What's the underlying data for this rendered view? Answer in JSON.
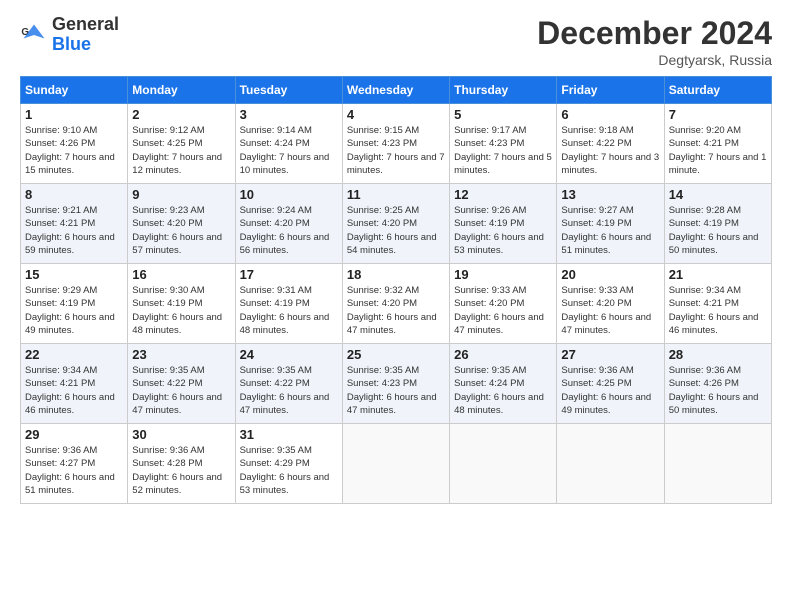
{
  "header": {
    "logo_general": "General",
    "logo_blue": "Blue",
    "month_title": "December 2024",
    "location": "Degtyarsk, Russia"
  },
  "days_of_week": [
    "Sunday",
    "Monday",
    "Tuesday",
    "Wednesday",
    "Thursday",
    "Friday",
    "Saturday"
  ],
  "weeks": [
    [
      {
        "day": "1",
        "sunrise": "9:10 AM",
        "sunset": "4:26 PM",
        "daylight": "7 hours and 15 minutes."
      },
      {
        "day": "2",
        "sunrise": "9:12 AM",
        "sunset": "4:25 PM",
        "daylight": "7 hours and 12 minutes."
      },
      {
        "day": "3",
        "sunrise": "9:14 AM",
        "sunset": "4:24 PM",
        "daylight": "7 hours and 10 minutes."
      },
      {
        "day": "4",
        "sunrise": "9:15 AM",
        "sunset": "4:23 PM",
        "daylight": "7 hours and 7 minutes."
      },
      {
        "day": "5",
        "sunrise": "9:17 AM",
        "sunset": "4:23 PM",
        "daylight": "7 hours and 5 minutes."
      },
      {
        "day": "6",
        "sunrise": "9:18 AM",
        "sunset": "4:22 PM",
        "daylight": "7 hours and 3 minutes."
      },
      {
        "day": "7",
        "sunrise": "9:20 AM",
        "sunset": "4:21 PM",
        "daylight": "7 hours and 1 minute."
      }
    ],
    [
      {
        "day": "8",
        "sunrise": "9:21 AM",
        "sunset": "4:21 PM",
        "daylight": "6 hours and 59 minutes."
      },
      {
        "day": "9",
        "sunrise": "9:23 AM",
        "sunset": "4:20 PM",
        "daylight": "6 hours and 57 minutes."
      },
      {
        "day": "10",
        "sunrise": "9:24 AM",
        "sunset": "4:20 PM",
        "daylight": "6 hours and 56 minutes."
      },
      {
        "day": "11",
        "sunrise": "9:25 AM",
        "sunset": "4:20 PM",
        "daylight": "6 hours and 54 minutes."
      },
      {
        "day": "12",
        "sunrise": "9:26 AM",
        "sunset": "4:19 PM",
        "daylight": "6 hours and 53 minutes."
      },
      {
        "day": "13",
        "sunrise": "9:27 AM",
        "sunset": "4:19 PM",
        "daylight": "6 hours and 51 minutes."
      },
      {
        "day": "14",
        "sunrise": "9:28 AM",
        "sunset": "4:19 PM",
        "daylight": "6 hours and 50 minutes."
      }
    ],
    [
      {
        "day": "15",
        "sunrise": "9:29 AM",
        "sunset": "4:19 PM",
        "daylight": "6 hours and 49 minutes."
      },
      {
        "day": "16",
        "sunrise": "9:30 AM",
        "sunset": "4:19 PM",
        "daylight": "6 hours and 48 minutes."
      },
      {
        "day": "17",
        "sunrise": "9:31 AM",
        "sunset": "4:19 PM",
        "daylight": "6 hours and 48 minutes."
      },
      {
        "day": "18",
        "sunrise": "9:32 AM",
        "sunset": "4:20 PM",
        "daylight": "6 hours and 47 minutes."
      },
      {
        "day": "19",
        "sunrise": "9:33 AM",
        "sunset": "4:20 PM",
        "daylight": "6 hours and 47 minutes."
      },
      {
        "day": "20",
        "sunrise": "9:33 AM",
        "sunset": "4:20 PM",
        "daylight": "6 hours and 47 minutes."
      },
      {
        "day": "21",
        "sunrise": "9:34 AM",
        "sunset": "4:21 PM",
        "daylight": "6 hours and 46 minutes."
      }
    ],
    [
      {
        "day": "22",
        "sunrise": "9:34 AM",
        "sunset": "4:21 PM",
        "daylight": "6 hours and 46 minutes."
      },
      {
        "day": "23",
        "sunrise": "9:35 AM",
        "sunset": "4:22 PM",
        "daylight": "6 hours and 47 minutes."
      },
      {
        "day": "24",
        "sunrise": "9:35 AM",
        "sunset": "4:22 PM",
        "daylight": "6 hours and 47 minutes."
      },
      {
        "day": "25",
        "sunrise": "9:35 AM",
        "sunset": "4:23 PM",
        "daylight": "6 hours and 47 minutes."
      },
      {
        "day": "26",
        "sunrise": "9:35 AM",
        "sunset": "4:24 PM",
        "daylight": "6 hours and 48 minutes."
      },
      {
        "day": "27",
        "sunrise": "9:36 AM",
        "sunset": "4:25 PM",
        "daylight": "6 hours and 49 minutes."
      },
      {
        "day": "28",
        "sunrise": "9:36 AM",
        "sunset": "4:26 PM",
        "daylight": "6 hours and 50 minutes."
      }
    ],
    [
      {
        "day": "29",
        "sunrise": "9:36 AM",
        "sunset": "4:27 PM",
        "daylight": "6 hours and 51 minutes."
      },
      {
        "day": "30",
        "sunrise": "9:36 AM",
        "sunset": "4:28 PM",
        "daylight": "6 hours and 52 minutes."
      },
      {
        "day": "31",
        "sunrise": "9:35 AM",
        "sunset": "4:29 PM",
        "daylight": "6 hours and 53 minutes."
      },
      null,
      null,
      null,
      null
    ]
  ],
  "labels": {
    "sunrise": "Sunrise:",
    "sunset": "Sunset:",
    "daylight": "Daylight:"
  }
}
